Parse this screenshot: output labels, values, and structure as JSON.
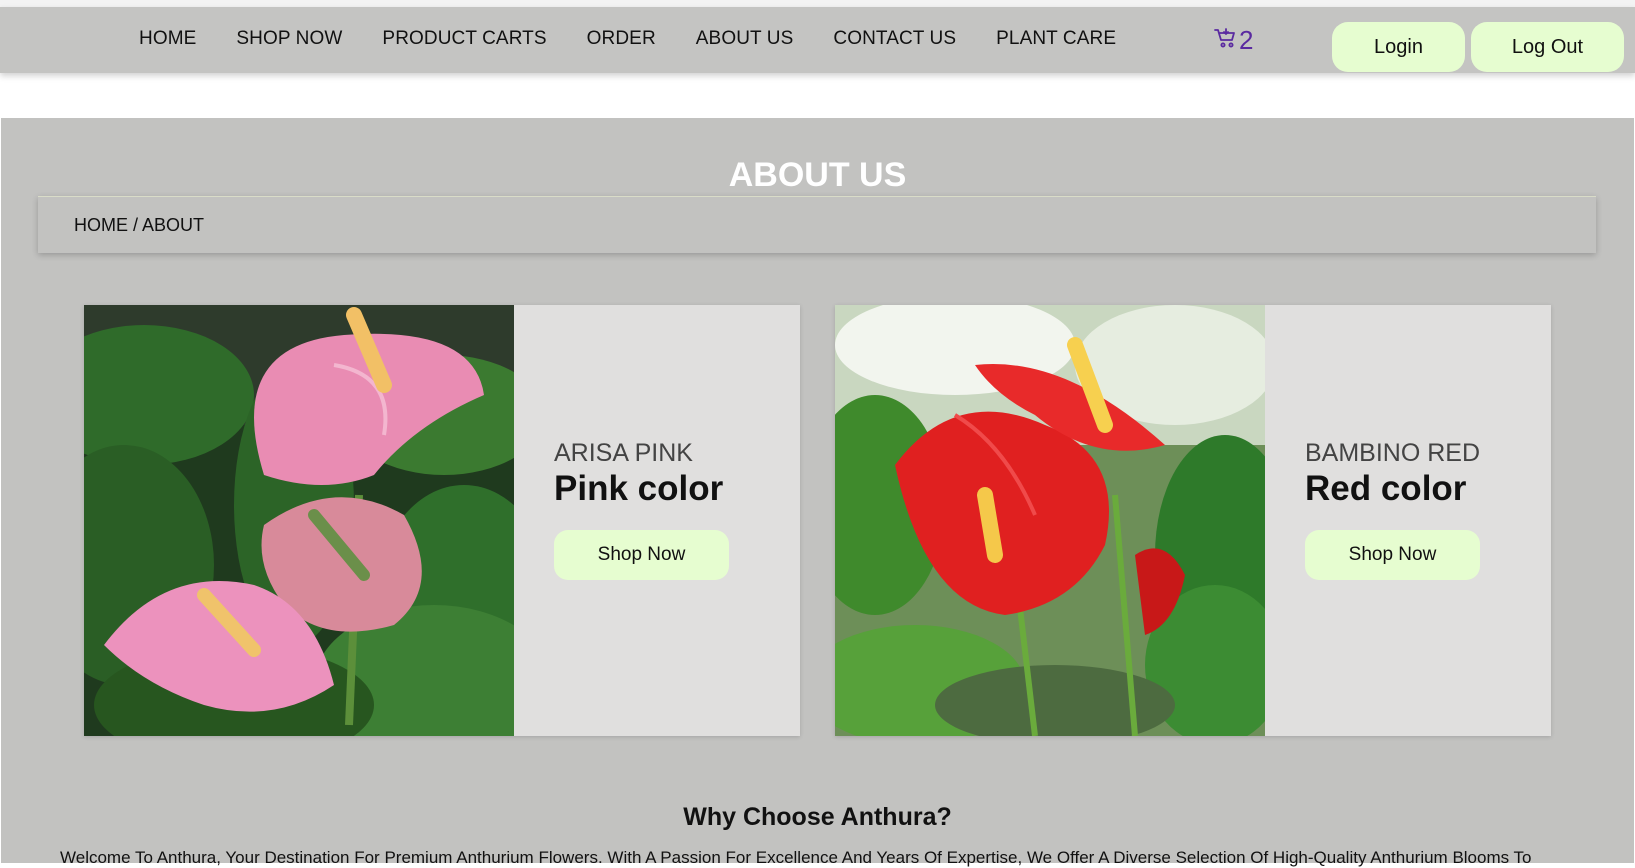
{
  "nav": {
    "links": [
      "HOME",
      "SHOP NOW",
      "PRODUCT CARTS",
      "ORDER",
      "ABOUT US",
      "CONTACT US",
      "PLANT CARE"
    ],
    "cart_count": "2",
    "login_label": "Login",
    "logout_label": "Log Out",
    "cart_icon": "cart-icon",
    "accent_color": "#5a2aa0",
    "button_color": "#e6fdd0"
  },
  "page": {
    "title": "ABOUT US",
    "breadcrumb": "HOME / ABOUT"
  },
  "cards": [
    {
      "subtitle": "ARISA PINK",
      "title": "Pink color",
      "button": "Shop Now",
      "image": "pink-anthurium-photo"
    },
    {
      "subtitle": "BAMBINO RED",
      "title": "Red color",
      "button": "Shop Now",
      "image": "red-anthurium-photo"
    }
  ],
  "why": {
    "title": "Why Choose Anthura?",
    "text": "Welcome To Anthura, Your Destination For Premium Anthurium Flowers. With A Passion For Excellence And Years Of Expertise, We Offer A Diverse Selection Of High-Quality Anthurium Blooms To"
  }
}
